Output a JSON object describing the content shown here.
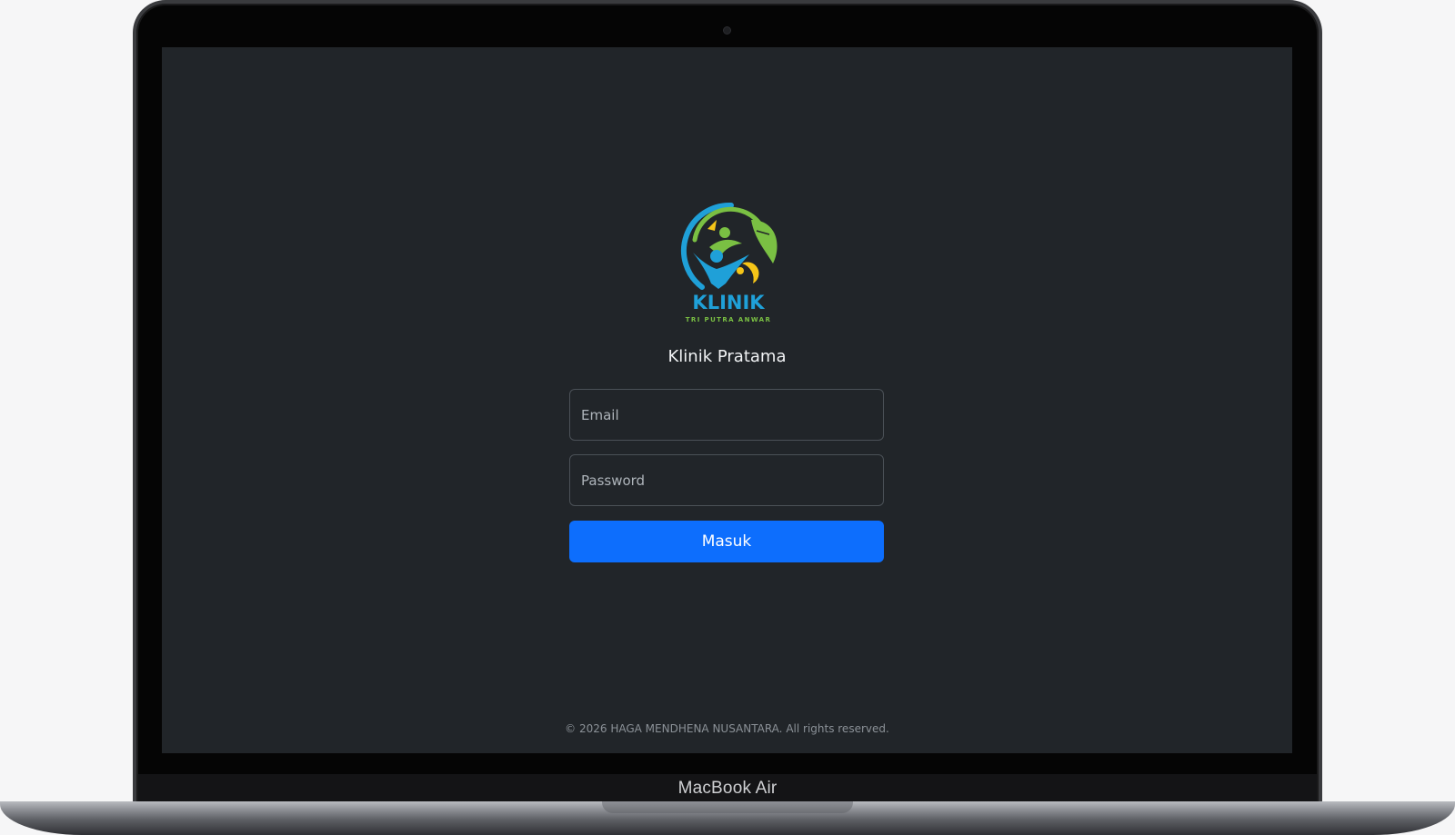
{
  "device": {
    "label": "MacBook Air"
  },
  "brand": {
    "logo_word": "KLINIK",
    "logo_tagline": "TRI PUTRA ANWAR",
    "colors": {
      "blue": "#1fa0d8",
      "green": "#7ac043",
      "yellow": "#f5c518"
    }
  },
  "login": {
    "title": "Klinik Pratama",
    "email_placeholder": "Email",
    "password_placeholder": "Password",
    "submit_label": "Masuk",
    "submit_color": "#0d6efd"
  },
  "footer": {
    "copyright": "© 2026 HAGA MENDHENA NUSANTARA. All rights reserved."
  },
  "theme": {
    "background": "#212529"
  }
}
